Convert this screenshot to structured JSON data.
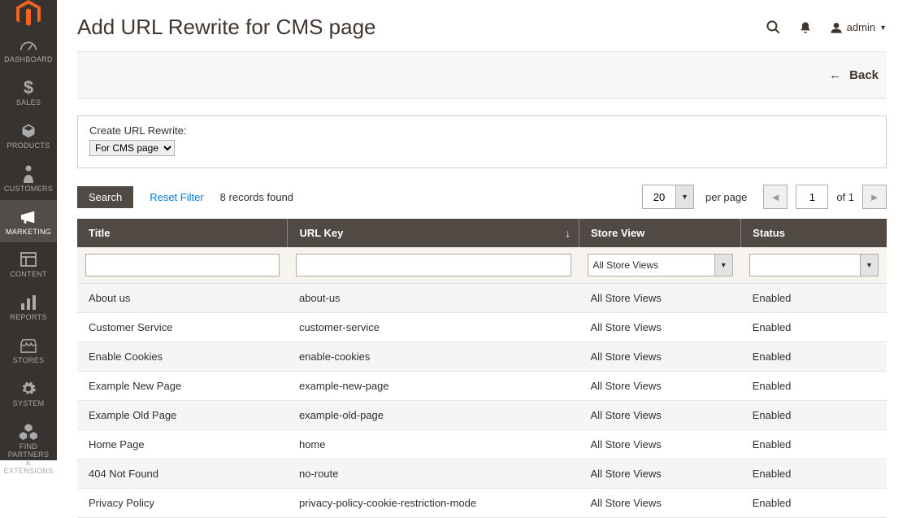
{
  "page": {
    "title": "Add URL Rewrite for CMS page"
  },
  "header": {
    "user_label": "admin"
  },
  "sidebar": {
    "items": [
      {
        "label": "DASHBOARD",
        "icon": "dashboard"
      },
      {
        "label": "SALES",
        "icon": "dollar"
      },
      {
        "label": "PRODUCTS",
        "icon": "box"
      },
      {
        "label": "CUSTOMERS",
        "icon": "person"
      },
      {
        "label": "MARKETING",
        "icon": "megaphone",
        "active": true
      },
      {
        "label": "CONTENT",
        "icon": "layout"
      },
      {
        "label": "REPORTS",
        "icon": "bars"
      },
      {
        "label": "STORES",
        "icon": "storefront"
      },
      {
        "label": "SYSTEM",
        "icon": "gear"
      },
      {
        "label": "FIND PARTNERS & EXTENSIONS",
        "icon": "cubes"
      }
    ]
  },
  "toolbar": {
    "back_label": "Back"
  },
  "create": {
    "label": "Create URL Rewrite:",
    "selected": "For CMS page"
  },
  "grid_controls": {
    "search_label": "Search",
    "reset_label": "Reset Filter",
    "records_found": "8 records found",
    "per_page_value": "20",
    "per_page_label": "per page",
    "page_value": "1",
    "of_label": "of 1"
  },
  "columns": {
    "title": "Title",
    "url_key": "URL Key",
    "store_view": "Store View",
    "status": "Status"
  },
  "filters": {
    "store_view_selected": "All Store Views"
  },
  "rows": [
    {
      "title": "About us",
      "url_key": "about-us",
      "store_view": "All Store Views",
      "status": "Enabled"
    },
    {
      "title": "Customer Service",
      "url_key": "customer-service",
      "store_view": "All Store Views",
      "status": "Enabled"
    },
    {
      "title": "Enable Cookies",
      "url_key": "enable-cookies",
      "store_view": "All Store Views",
      "status": "Enabled"
    },
    {
      "title": "Example New Page",
      "url_key": "example-new-page",
      "store_view": "All Store Views",
      "status": "Enabled"
    },
    {
      "title": "Example Old Page",
      "url_key": "example-old-page",
      "store_view": "All Store Views",
      "status": "Enabled"
    },
    {
      "title": "Home Page",
      "url_key": "home",
      "store_view": "All Store Views",
      "status": "Enabled"
    },
    {
      "title": "404 Not Found",
      "url_key": "no-route",
      "store_view": "All Store Views",
      "status": "Enabled"
    },
    {
      "title": "Privacy Policy",
      "url_key": "privacy-policy-cookie-restriction-mode",
      "store_view": "All Store Views",
      "status": "Enabled"
    }
  ]
}
